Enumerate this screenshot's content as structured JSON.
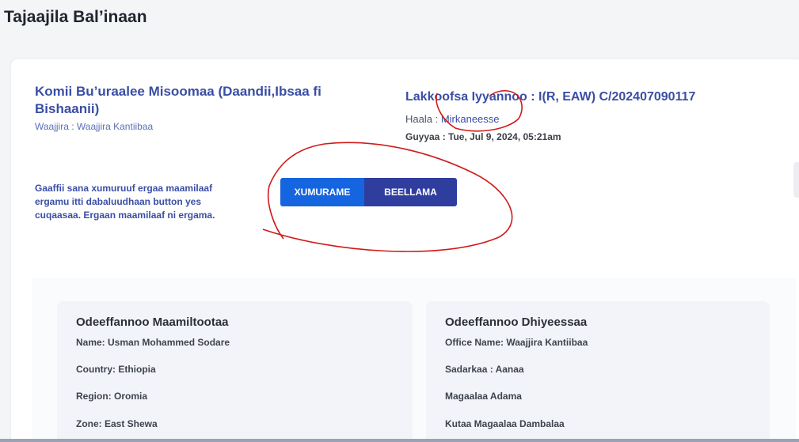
{
  "page": {
    "title": "Tajaajila Bal’inaan"
  },
  "service": {
    "title": "Komii Bu’uraalee Misoomaa (Daandii,Ibsaa fi Bishaanii)",
    "office_line": "Waajjira : Waajjira Kantiibaa"
  },
  "request": {
    "number_line": "Lakkoofsa Iyyannoo : I(R, EAW) C/202407090117",
    "status_label": "Haala : ",
    "status_value": "Mirkaneesse",
    "date_line": "Guyyaa : Tue, Jul 9, 2024, 05:21am"
  },
  "instruction": "Gaaffii sana xumuruuf ergaa maamilaaf ergamu itti dabaluudhaan button yes cuqaasaa. Ergaan maamilaaf ni ergama.",
  "actions": {
    "finish_label": "XUMURAME",
    "reply_label": "BEELLAMA"
  },
  "customer_info": {
    "heading": "Odeeffannoo Maamiltootaa",
    "rows": [
      "Name: Usman Mohammed Sodare",
      "Country: Ethiopia",
      "Region: Oromia",
      "Zone: East Shewa"
    ]
  },
  "provider_info": {
    "heading": "Odeeffannoo Dhiyeessaa",
    "rows": [
      "Office Name: Waajjira Kantiibaa",
      "Sadarkaa : Aanaa",
      "Magaalaa Adama",
      "Kutaa Magaalaa Dambalaa"
    ]
  },
  "colors": {
    "accent": "#3a4ea5",
    "primary_button": "#1565e0",
    "secondary_button": "#2f3e9e",
    "annotation": "#d11a1a"
  }
}
